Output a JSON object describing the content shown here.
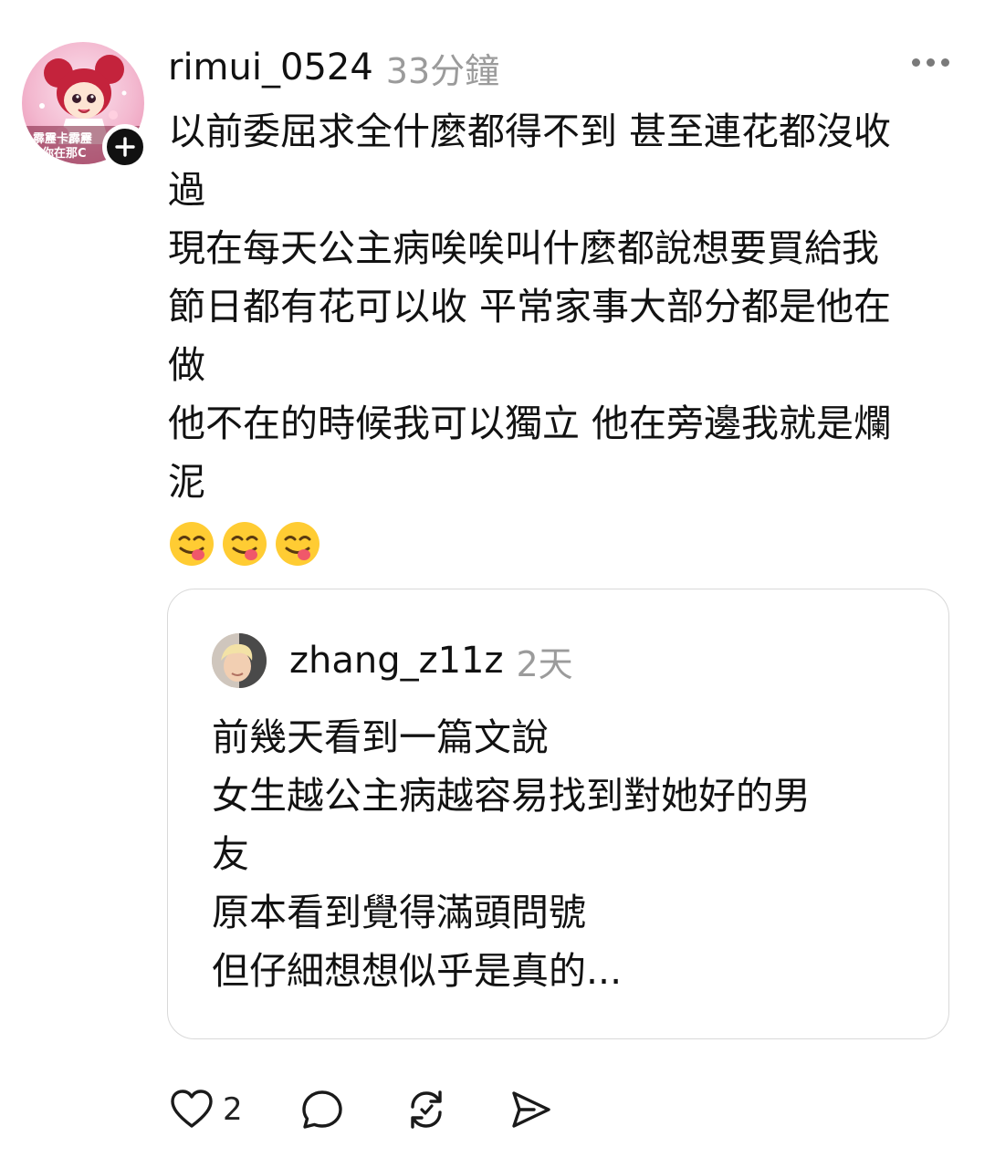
{
  "post": {
    "username": "rimui_0524",
    "time": "33分鐘",
    "avatar_text": [
      "霹靂卡霹靂",
      "你在那C"
    ],
    "lines": [
      "以前委屈求全什麼都得不到 甚至連花都沒收",
      "過",
      "現在每天公主病唉唉叫什麼都說想要買給我",
      "節日都有花可以收 平常家事大部分都是他在",
      "做",
      "他不在的時候我可以獨立 他在旁邊我就是爛",
      "泥"
    ],
    "emojis": [
      "😋",
      "😋",
      "😋"
    ]
  },
  "quote": {
    "username": "zhang_z11z",
    "time": "2天",
    "lines": [
      "前幾天看到一篇文說",
      "女生越公主病越容易找到對她好的男",
      "友",
      "原本看到覺得滿頭問號",
      "但仔細想想似乎是真的..."
    ]
  },
  "actions": {
    "like_count": "2"
  },
  "icons": {
    "more": "more-icon",
    "follow": "plus-icon",
    "like": "heart-icon",
    "comment": "comment-icon",
    "repost": "repost-icon",
    "share": "send-icon"
  },
  "colors": {
    "text": "#111111",
    "muted": "#9b9b9b",
    "border": "#d9d9d9"
  }
}
